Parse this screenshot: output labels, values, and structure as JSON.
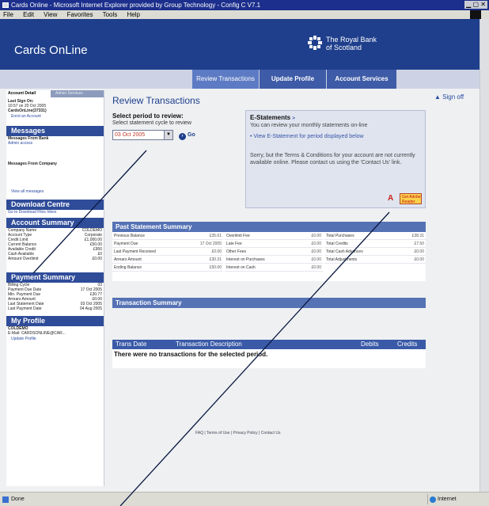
{
  "window": {
    "title": "Cards Online - Microsoft Internet Explorer provided by Group Technology - Config C V7.1",
    "menu": [
      "File",
      "Edit",
      "View",
      "Favorites",
      "Tools",
      "Help"
    ]
  },
  "header": {
    "brand": "Cards OnLine",
    "bank_line1": "The Royal Bank",
    "bank_line2": "of Scotland"
  },
  "nav": {
    "review": "Review Transactions",
    "profile": "Update Profile",
    "services": "Account Services"
  },
  "sidebar": {
    "tab_active": "Account Detail",
    "tab_other": "Admin Services",
    "last_signon_label": "Last Sign On:",
    "last_signon_value": "10:57 on 20 Oct 2005",
    "account_ref": "CardsOnLine(37331)",
    "enrol_link": "Enrol an Account",
    "messages_head": "Messages",
    "from_bank": "Messages From Bank",
    "admin_access": "Admin access",
    "from_company": "Messages From Company",
    "view_all": "View all messages",
    "download_head": "Download Centre",
    "download_link": "Go to Download Files Inbox",
    "acct_head": "Account Summary",
    "acct_rows": [
      [
        "Company Name",
        "COLDEMO"
      ],
      [
        "Account Type",
        "Corporate"
      ],
      [
        "Credit Limit",
        "£1,000.00"
      ],
      [
        "Current Balance",
        "£50.00"
      ],
      [
        "Available Credit",
        "£950"
      ],
      [
        "Cash Available",
        "£0"
      ],
      [
        "Amount Overlimit",
        "£0.00"
      ]
    ],
    "pay_head": "Payment Summary",
    "pay_rows": [
      [
        "Billing Cycle",
        "03"
      ],
      [
        "Payment Due Date",
        "17 Oct 2005"
      ],
      [
        "Min. Payment Due",
        "£30.77"
      ],
      [
        "Arrears Amount",
        "£0.00"
      ],
      [
        "Last Statement Date",
        "03 Oct 2005"
      ],
      [
        "Last Payment Date",
        "04 Aug 2005"
      ]
    ],
    "profile_head": "My Profile",
    "profile_name": "COLDEMO",
    "profile_email": "E-Mail: CARDSONLINE@CAR...",
    "update_profile": "Update Profile"
  },
  "main": {
    "title": "Review Transactions",
    "signoff": "Sign off",
    "period_label": "Select period to review:",
    "cycle_label": "Select statement cycle to review",
    "cycle_value": "03 Oct 2005",
    "go": "Go"
  },
  "estatements": {
    "title": "E-Statements",
    "intro": "You can review your monthly statements on-line",
    "link": "View E-Statement for period displayed below",
    "sorry": "Sorry, but the Terms & Conditions for your account are not currently available online. Please contact us using the 'Contact Us' link.",
    "adobe": "Get Adobe Reader"
  },
  "past_summary": {
    "title": "Past Statement Summary",
    "col1": [
      [
        "Previous Balance",
        "£35.61"
      ],
      [
        "Payment Due",
        "17 Oct 2005"
      ],
      [
        "Last Payment Received",
        "£0.00"
      ],
      [
        "Arrears Amount",
        "£30.31"
      ],
      [
        "Ending Balance",
        "£50.00"
      ]
    ],
    "col2": [
      [
        "Overlimit Fee",
        "£0.00"
      ],
      [
        "Late Fee",
        "£0.00"
      ],
      [
        "Other Fees",
        "£0.00"
      ],
      [
        "Interest on Purchases",
        "£0.00"
      ],
      [
        "Interest on Cash",
        "£0.00"
      ]
    ],
    "col3": [
      [
        "Total Purchases",
        "£38.31"
      ],
      [
        "Total Credits",
        "£7.50"
      ],
      [
        "Total Cash Advances",
        "£0.00"
      ],
      [
        "Total Adjustments",
        "£0.00"
      ]
    ]
  },
  "txn": {
    "title": "Transaction Summary",
    "col_date": "Trans Date",
    "col_desc": "Transaction Description",
    "col_debits": "Debits",
    "col_credits": "Credits",
    "empty": "There were no transactions for the selected period."
  },
  "footer": {
    "links": "FAQ | Terms of Use | Privacy Policy | Contact Us"
  },
  "status": {
    "left": "Done",
    "zone": "Internet"
  }
}
